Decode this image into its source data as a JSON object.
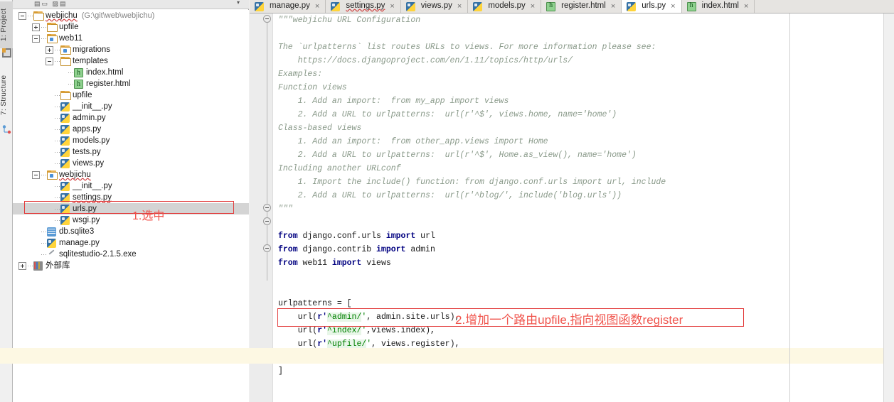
{
  "toolwindows": {
    "project_label": "1: Project",
    "structure_label": "7: Structure",
    "project_icon": "project-window-icon",
    "structure_icon": "structure-window-icon"
  },
  "project_panel": {
    "header": {
      "collapse_all_icon": "collapse-all-icon",
      "settings_icon": "gear-icon",
      "hide_icon": "hide-panel-icon",
      "dropdown_icon": "chevron-down-icon"
    },
    "tree": [
      {
        "depth": 0,
        "toggle": "minus",
        "icon": "folder-icon",
        "label": "webjichu",
        "path": "(G:\\git\\web\\webjichu)",
        "squiggle": true,
        "selected": false
      },
      {
        "depth": 1,
        "toggle": "plus",
        "icon": "folder-icon",
        "label": "upfile",
        "path": "",
        "squiggle": false,
        "selected": false
      },
      {
        "depth": 1,
        "toggle": "minus",
        "icon": "folder-module-icon",
        "label": "web11",
        "path": "",
        "squiggle": false,
        "selected": false
      },
      {
        "depth": 2,
        "toggle": "plus",
        "icon": "folder-module-icon",
        "label": "migrations",
        "path": "",
        "squiggle": false,
        "selected": false
      },
      {
        "depth": 2,
        "toggle": "minus",
        "icon": "folder-icon",
        "label": "templates",
        "path": "",
        "squiggle": false,
        "selected": false
      },
      {
        "depth": 3,
        "toggle": "none",
        "icon": "html-file-icon",
        "label": "index.html",
        "path": "",
        "squiggle": false,
        "selected": false
      },
      {
        "depth": 3,
        "toggle": "none",
        "icon": "html-file-icon",
        "label": "register.html",
        "path": "",
        "squiggle": false,
        "selected": false
      },
      {
        "depth": 2,
        "toggle": "none",
        "icon": "folder-icon",
        "label": "upfile",
        "path": "",
        "squiggle": false,
        "selected": false
      },
      {
        "depth": 2,
        "toggle": "none",
        "icon": "python-file-icon",
        "label": "__init__.py",
        "path": "",
        "squiggle": false,
        "selected": false
      },
      {
        "depth": 2,
        "toggle": "none",
        "icon": "python-file-icon",
        "label": "admin.py",
        "path": "",
        "squiggle": false,
        "selected": false
      },
      {
        "depth": 2,
        "toggle": "none",
        "icon": "python-file-icon",
        "label": "apps.py",
        "path": "",
        "squiggle": false,
        "selected": false
      },
      {
        "depth": 2,
        "toggle": "none",
        "icon": "python-file-icon",
        "label": "models.py",
        "path": "",
        "squiggle": false,
        "selected": false
      },
      {
        "depth": 2,
        "toggle": "none",
        "icon": "python-file-icon",
        "label": "tests.py",
        "path": "",
        "squiggle": false,
        "selected": false
      },
      {
        "depth": 2,
        "toggle": "none",
        "icon": "python-file-icon",
        "label": "views.py",
        "path": "",
        "squiggle": false,
        "selected": false
      },
      {
        "depth": 1,
        "toggle": "minus",
        "icon": "folder-module-icon",
        "label": "webjichu",
        "path": "",
        "squiggle": true,
        "selected": false
      },
      {
        "depth": 2,
        "toggle": "none",
        "icon": "python-file-icon",
        "label": "__init__.py",
        "path": "",
        "squiggle": false,
        "selected": false
      },
      {
        "depth": 2,
        "toggle": "none",
        "icon": "python-file-icon",
        "label": "settings.py",
        "path": "",
        "squiggle": true,
        "selected": false
      },
      {
        "depth": 2,
        "toggle": "none",
        "icon": "python-file-icon",
        "label": "urls.py",
        "path": "",
        "squiggle": false,
        "selected": true
      },
      {
        "depth": 2,
        "toggle": "none",
        "icon": "python-file-icon",
        "label": "wsgi.py",
        "path": "",
        "squiggle": false,
        "selected": false
      },
      {
        "depth": 1,
        "toggle": "none",
        "icon": "database-file-icon",
        "label": "db.sqlite3",
        "path": "",
        "squiggle": false,
        "selected": false
      },
      {
        "depth": 1,
        "toggle": "none",
        "icon": "python-file-icon",
        "label": "manage.py",
        "path": "",
        "squiggle": false,
        "selected": false
      },
      {
        "depth": 1,
        "toggle": "none",
        "icon": "exe-file-icon",
        "label": "sqlitestudio-2.1.5.exe",
        "path": "",
        "squiggle": false,
        "selected": false
      },
      {
        "depth": 0,
        "toggle": "plus",
        "icon": "external-libraries-icon",
        "label": "外部库",
        "path": "",
        "squiggle": false,
        "selected": false
      }
    ]
  },
  "annotations": {
    "step1": "1.选中",
    "step2": "2.增加一个路由upfile,指向视图函数register",
    "color": "#f0544c"
  },
  "editor": {
    "tabs": [
      {
        "label": "manage.py",
        "icon": "python-file-icon",
        "active": false,
        "squiggle": false,
        "close": "×"
      },
      {
        "label": "settings.py",
        "icon": "python-file-icon",
        "active": false,
        "squiggle": true,
        "close": "×"
      },
      {
        "label": "views.py",
        "icon": "python-file-icon",
        "active": false,
        "squiggle": false,
        "close": "×"
      },
      {
        "label": "models.py",
        "icon": "python-file-icon",
        "active": false,
        "squiggle": false,
        "close": "×"
      },
      {
        "label": "register.html",
        "icon": "html-file-icon",
        "active": false,
        "squiggle": false,
        "close": "×"
      },
      {
        "label": "urls.py",
        "icon": "python-file-icon",
        "active": true,
        "squiggle": false,
        "close": "×"
      },
      {
        "label": "index.html",
        "icon": "html-file-icon",
        "active": false,
        "squiggle": false,
        "close": "×"
      }
    ],
    "lines": [
      {
        "type": "doc",
        "text": "\"\"\"webjichu URL Configuration"
      },
      {
        "type": "doc",
        "text": ""
      },
      {
        "type": "doc",
        "text": "The `urlpatterns` list routes URLs to views. For more information please see:"
      },
      {
        "type": "doc",
        "text": "    https://docs.djangoproject.com/en/1.11/topics/http/urls/"
      },
      {
        "type": "doc",
        "text": "Examples:"
      },
      {
        "type": "doc",
        "text": "Function views"
      },
      {
        "type": "doc",
        "text": "    1. Add an import:  from my_app import views"
      },
      {
        "type": "doc",
        "text": "    2. Add a URL to urlpatterns:  url(r'^$', views.home, name='home')"
      },
      {
        "type": "doc",
        "text": "Class-based views"
      },
      {
        "type": "doc",
        "text": "    1. Add an import:  from other_app.views import Home"
      },
      {
        "type": "doc",
        "text": "    2. Add a URL to urlpatterns:  url(r'^$', Home.as_view(), name='home')"
      },
      {
        "type": "doc",
        "text": "Including another URLconf"
      },
      {
        "type": "doc",
        "text": "    1. Import the include() function: from django.conf.urls import url, include"
      },
      {
        "type": "doc",
        "text": "    2. Add a URL to urlpatterns:  url(r'^blog/', include('blog.urls'))"
      },
      {
        "type": "doc",
        "text": "\"\"\""
      },
      {
        "type": "blank",
        "text": ""
      },
      {
        "type": "import",
        "kw1": "from",
        "mod": " django.conf.urls ",
        "kw2": "import",
        "rest": " url"
      },
      {
        "type": "import",
        "kw1": "from",
        "mod": " django.contrib ",
        "kw2": "import",
        "rest": " admin"
      },
      {
        "type": "import",
        "kw1": "from",
        "mod": " web11 ",
        "kw2": "import",
        "rest": " views"
      },
      {
        "type": "blank",
        "text": ""
      },
      {
        "type": "blank",
        "text": ""
      },
      {
        "type": "plain",
        "text": "urlpatterns = ["
      },
      {
        "type": "url",
        "indent": "    url(",
        "prefix": "r'",
        "str": "^admin/",
        "quote": "'",
        "rest": ", admin.site.urls),"
      },
      {
        "type": "url",
        "indent": "    url(",
        "prefix": "r'",
        "str": "^index/",
        "quote": "'",
        "rest": ",views.index),"
      },
      {
        "type": "url",
        "indent": "    url(",
        "prefix": "r'",
        "str": "^upfile/",
        "quote": "'",
        "rest": ", views.register),"
      },
      {
        "type": "blank",
        "text": ""
      },
      {
        "type": "plain",
        "text": "]"
      }
    ]
  }
}
